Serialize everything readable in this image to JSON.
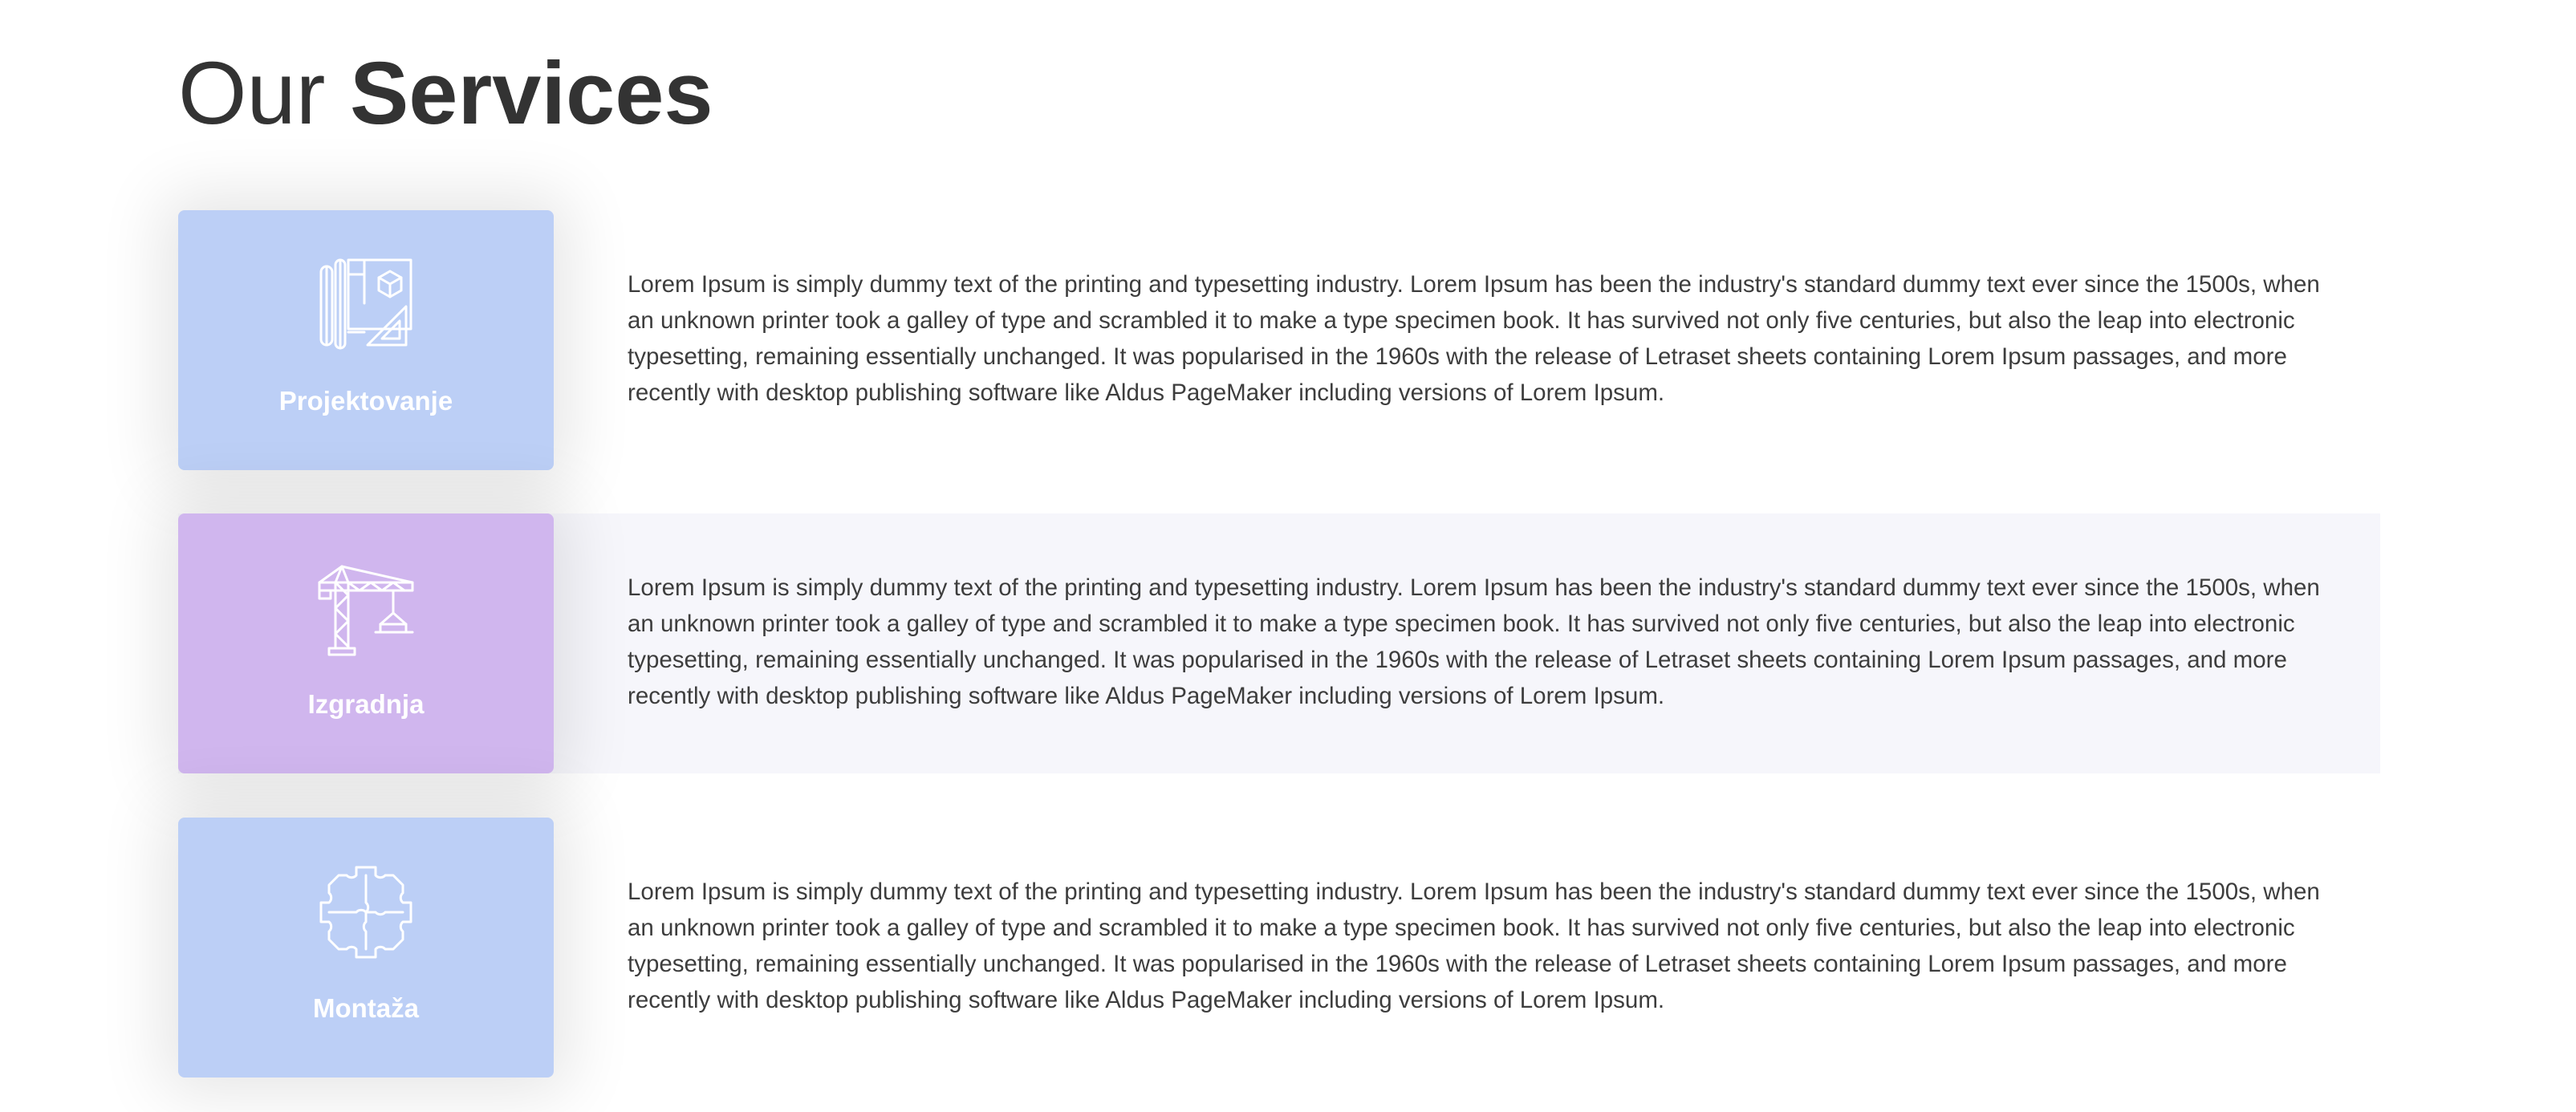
{
  "heading": {
    "light": "Our",
    "bold": "Services"
  },
  "services": [
    {
      "title": "Projektovanje",
      "icon": "blueprint-icon",
      "description": "Lorem Ipsum is simply dummy text of the printing and typesetting industry. Lorem Ipsum has been the industry's standard dummy text ever since the 1500s, when an unknown printer took a galley of type and scrambled it to make a type specimen book. It has survived not only five centuries, but also the leap into electronic typesetting, remaining essentially unchanged. It was popularised in the 1960s with the release of Letraset sheets containing Lorem Ipsum passages, and more recently with desktop publishing software like Aldus PageMaker including versions of Lorem Ipsum.",
      "card_color": "#bccff6"
    },
    {
      "title": "Izgradnja",
      "icon": "crane-icon",
      "description": "Lorem Ipsum is simply dummy text of the printing and typesetting industry. Lorem Ipsum has been the industry's standard dummy text ever since the 1500s, when an unknown printer took a galley of type and scrambled it to make a type specimen book. It has survived not only five centuries, but also the leap into electronic typesetting, remaining essentially unchanged. It was popularised in the 1960s with the release of Letraset sheets containing Lorem Ipsum passages, and more recently with desktop publishing software like Aldus PageMaker including versions of Lorem Ipsum.",
      "card_color": "#d0b6ee"
    },
    {
      "title": "Montaža",
      "icon": "puzzle-icon",
      "description": "Lorem Ipsum is simply dummy text of the printing and typesetting industry. Lorem Ipsum has been the industry's standard dummy text ever since the 1500s, when an unknown printer took a galley of type and scrambled it to make a type specimen book. It has survived not only five centuries, but also the leap into electronic typesetting, remaining essentially unchanged. It was popularised in the 1960s with the release of Letraset sheets containing Lorem Ipsum passages, and more recently with desktop publishing software like Aldus PageMaker including versions of Lorem Ipsum.",
      "card_color": "#bccff6"
    }
  ],
  "colors": {
    "highlight_row": "#f6f6fb",
    "text": "#333333"
  }
}
